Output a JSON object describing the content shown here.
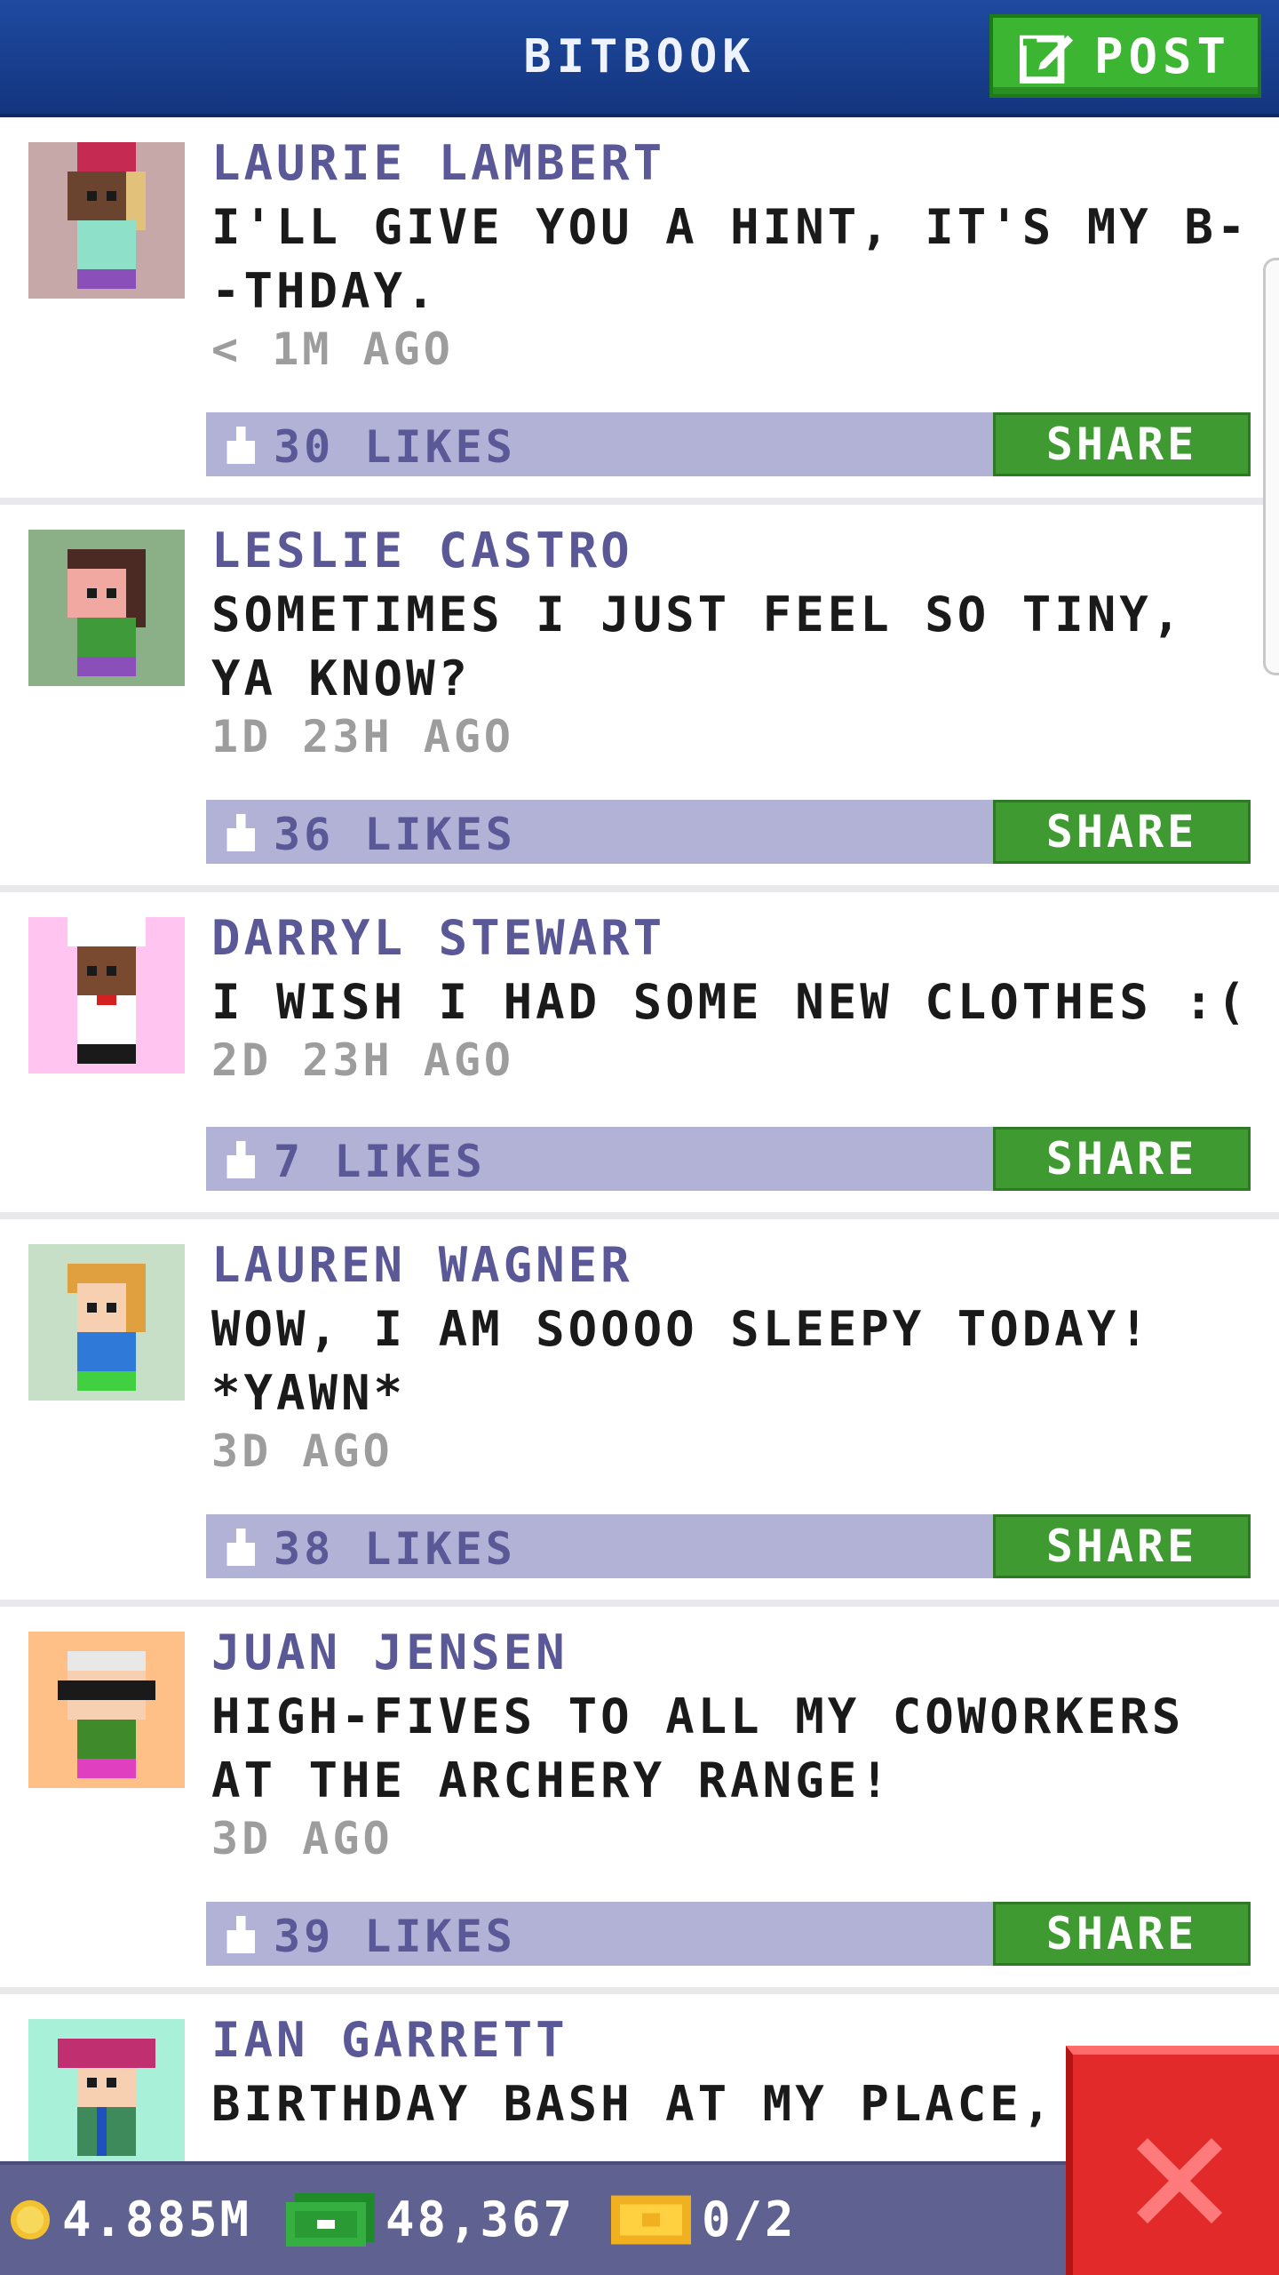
{
  "header": {
    "title": "BITBOOK",
    "post_label": "POST",
    "post_icon": "edit-icon"
  },
  "posts": [
    {
      "author": "LAURIE LAMBERT",
      "message": "I'LL GIVE YOU A HINT, IT'S MY B--THDAY.",
      "time": "< 1M AGO",
      "likes": "30 LIKES",
      "share": "SHARE"
    },
    {
      "author": "LESLIE CASTRO",
      "message": "SOMETIMES I JUST FEEL SO TINY, YA KNOW?",
      "time": "1D 23H AGO",
      "likes": "36 LIKES",
      "share": "SHARE"
    },
    {
      "author": "DARRYL STEWART",
      "message": "I WISH I HAD SOME NEW CLOTHES :(",
      "time": "2D 23H AGO",
      "likes": "7 LIKES",
      "share": "SHARE"
    },
    {
      "author": "LAUREN WAGNER",
      "message": "WOW, I AM SOOOO SLEEPY TODAY! *YAWN*",
      "time": "3D AGO",
      "likes": "38 LIKES",
      "share": "SHARE"
    },
    {
      "author": "JUAN JENSEN",
      "message": "HIGH-FIVES TO ALL MY COWORKERS AT THE ARCHERY RANGE!",
      "time": "3D AGO",
      "likes": "39 LIKES",
      "share": "SHARE"
    },
    {
      "author": "IAN GARRETT",
      "message": "BIRTHDAY BASH AT MY PLACE, B"
    }
  ],
  "status": {
    "coins": "4.885M",
    "bux": "48,367",
    "tickets": "0/2"
  },
  "colors": {
    "header": "#1e4aa0",
    "accent_green": "#3f9a32",
    "like_bar": "#b2b1d6",
    "author": "#5a5896",
    "close": "#e22a2a"
  }
}
